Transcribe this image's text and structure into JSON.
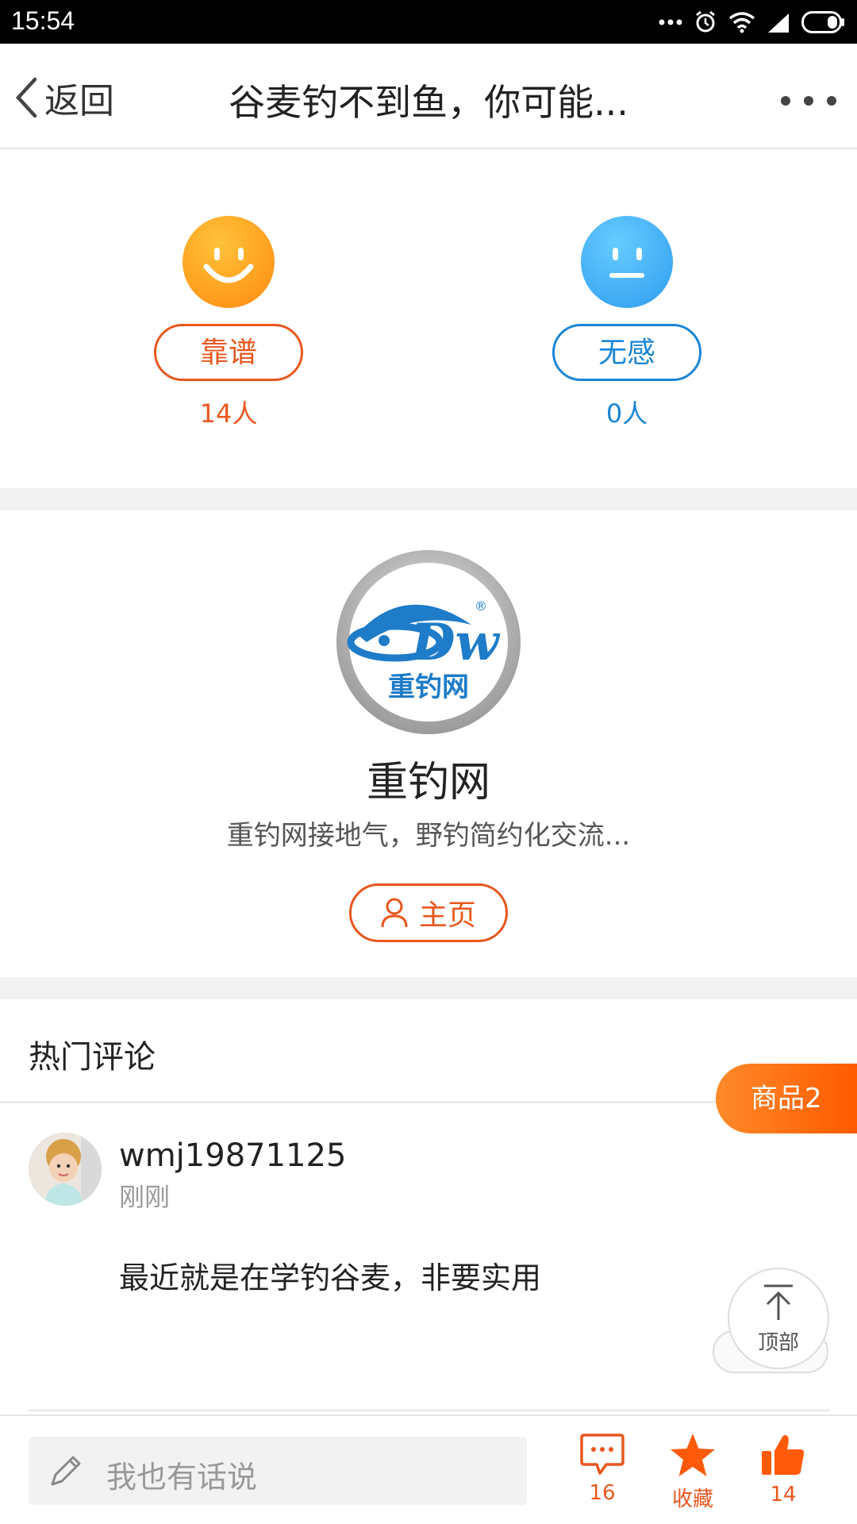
{
  "status_bar": {
    "time": "15:54"
  },
  "nav": {
    "back_label": "返回",
    "title": "谷麦钓不到鱼，你可能..."
  },
  "vote": {
    "like_label": "靠谱",
    "like_count": "14人",
    "neutral_label": "无感",
    "neutral_count": "0人"
  },
  "author": {
    "logo_text": "重钓网",
    "name": "重钓网",
    "description": "重钓网接地气，野钓简约化交流...",
    "home_label": "主页"
  },
  "comments": {
    "title": "热门评论",
    "items": [
      {
        "user": "wmj19871125",
        "time": "刚刚",
        "text": "最近就是在学钓谷麦，非要实用"
      }
    ]
  },
  "float": {
    "goods_label": "商品2",
    "totop_label": "顶部"
  },
  "bottom_bar": {
    "input_placeholder": "我也有话说",
    "comment_count": "16",
    "favorite_label": "收藏",
    "like_count": "14"
  },
  "colors": {
    "accent": "#e8571e",
    "blue": "#1a86d6"
  },
  "icons": [
    "back-chevron-icon",
    "more-icon",
    "smile-icon",
    "neutral-face-icon",
    "user-icon",
    "to-top-arrow-icon",
    "pencil-icon",
    "comment-icon",
    "star-icon",
    "thumbs-up-icon"
  ]
}
